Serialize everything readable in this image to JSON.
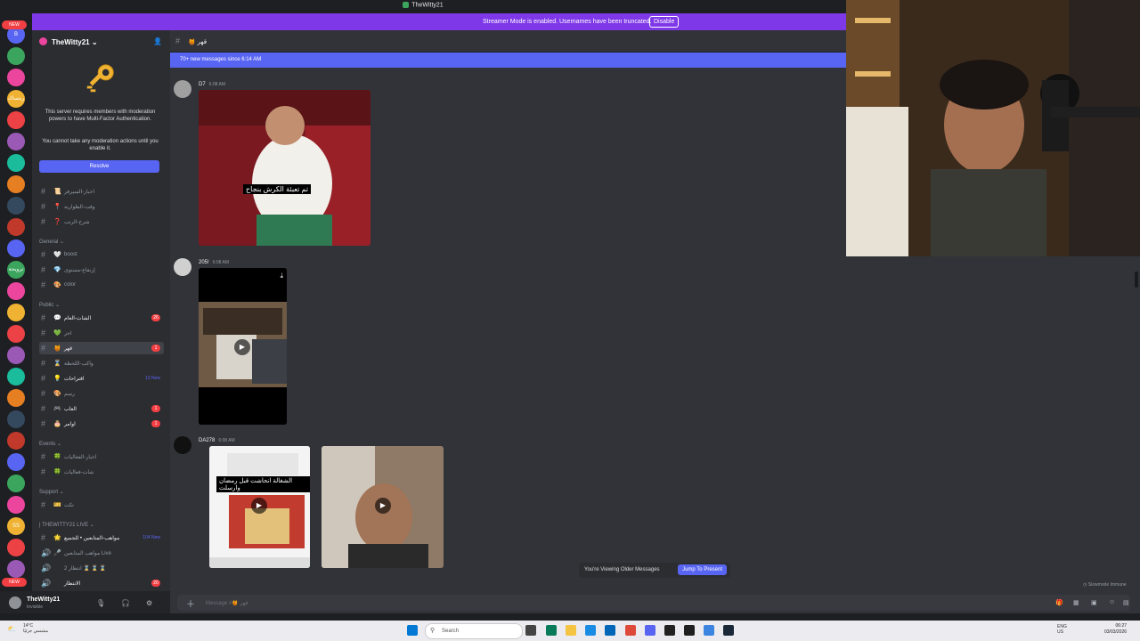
{
  "window": {
    "title": "TheWitty21"
  },
  "streamer_banner": {
    "message": "Streamer Mode is enabled. Usernames have been truncated.",
    "disable_label": "Disable"
  },
  "guilds": [
    {
      "text": "B"
    },
    {
      "text": ""
    },
    {
      "text": ""
    },
    {
      "text": "ريتساك"
    },
    {
      "text": ""
    },
    {
      "text": ""
    },
    {
      "text": ""
    },
    {
      "text": ""
    },
    {
      "text": ""
    },
    {
      "text": ""
    },
    {
      "text": ""
    },
    {
      "text": "ترويحة"
    },
    {
      "text": ""
    },
    {
      "text": ""
    },
    {
      "text": ""
    },
    {
      "text": ""
    },
    {
      "text": ""
    },
    {
      "text": ""
    },
    {
      "text": ""
    },
    {
      "text": ""
    },
    {
      "text": ""
    },
    {
      "text": ""
    },
    {
      "text": ""
    },
    {
      "text": "SS"
    },
    {
      "text": ""
    },
    {
      "text": ""
    }
  ],
  "guild_badges": [
    "NEW",
    "NEW"
  ],
  "server": {
    "name": "TheWitty21",
    "mfa_message": "This server requires members with moderation powers to have Multi-Factor Authentication.",
    "mfa_message2": "You cannot take any moderation actions until you enable it.",
    "resolve_label": "Resolve"
  },
  "categories": {
    "general": "General",
    "public": "Public",
    "events": "Events",
    "support": "Support",
    "live": "| THEWITTY21 LIVE"
  },
  "channels": [
    {
      "emoji": "📜",
      "label": "اخبار-السيرفر"
    },
    {
      "emoji": "📍",
      "label": "وقت-الظواريه"
    },
    {
      "emoji": "❓",
      "label": "شرح-الرتب"
    },
    {
      "emoji": "🤍",
      "label": "boost"
    },
    {
      "emoji": "💎",
      "label": "إرتفاع-مستوى"
    },
    {
      "emoji": "🎨",
      "label": "color"
    },
    {
      "emoji": "💬",
      "label": "الشات-العام",
      "badge": "26"
    },
    {
      "emoji": "💚",
      "label": "اجر"
    },
    {
      "emoji": "🍯",
      "label": "قهر",
      "badge": "1"
    },
    {
      "emoji": "⌛",
      "label": "واكب-اللحظة"
    },
    {
      "emoji": "💡",
      "label": "اقتراحات",
      "newbadge": "13 New"
    },
    {
      "emoji": "🎨",
      "label": "رسم"
    },
    {
      "emoji": "🎮",
      "label": "العاب",
      "badge": "1"
    },
    {
      "emoji": "🎂",
      "label": "اوامر",
      "badge": "1"
    },
    {
      "emoji": "🍀",
      "label": "اخبار-الفعاليات"
    },
    {
      "emoji": "🍀",
      "label": "شات-فعاليات"
    },
    {
      "emoji": "🎫",
      "label": "تكت"
    },
    {
      "emoji": "🌟",
      "label": "مواهب-المتابعين • للجميع",
      "newbadge": "104 New"
    },
    {
      "emoji": "🎤",
      "label": "مواهب المتابعين Live"
    },
    {
      "emoji": "",
      "label": "انتظار 2 ⌛ ⌛ ⌛"
    },
    {
      "emoji": "",
      "label": "الانتظار",
      "badge": "20"
    }
  ],
  "user": {
    "name": "TheWitty21",
    "status": "Invisible"
  },
  "chat": {
    "channel_name": "قهر",
    "new_messages": "70+ new messages since 6:14 AM",
    "older_message": "You're Viewing Older Messages",
    "jump_label": "Jump To Present",
    "input_placeholder": "Message #🍯 قهر",
    "slowmode": "Slowmode Immune"
  },
  "messages": [
    {
      "author": "D7",
      "time": "6:08 AM",
      "caption": "تم تعبئة الكرش بنجاح"
    },
    {
      "author": "205!",
      "time": "6:08 AM"
    },
    {
      "author": "DA278",
      "time": "6:08 AM",
      "caption": "الشغالة انحاشت قبل رمضان وارسلت"
    }
  ],
  "taskbar": {
    "weather_temp": "14°C",
    "weather_desc": "مشمس جزئيًا",
    "search_label": "Search",
    "lang": "ENG",
    "region": "US",
    "time": "06:27",
    "date": "03/03/2026"
  },
  "colors": {
    "accent": "#5865f2",
    "streamer": "#7f38e8",
    "badge": "#f23f43"
  }
}
